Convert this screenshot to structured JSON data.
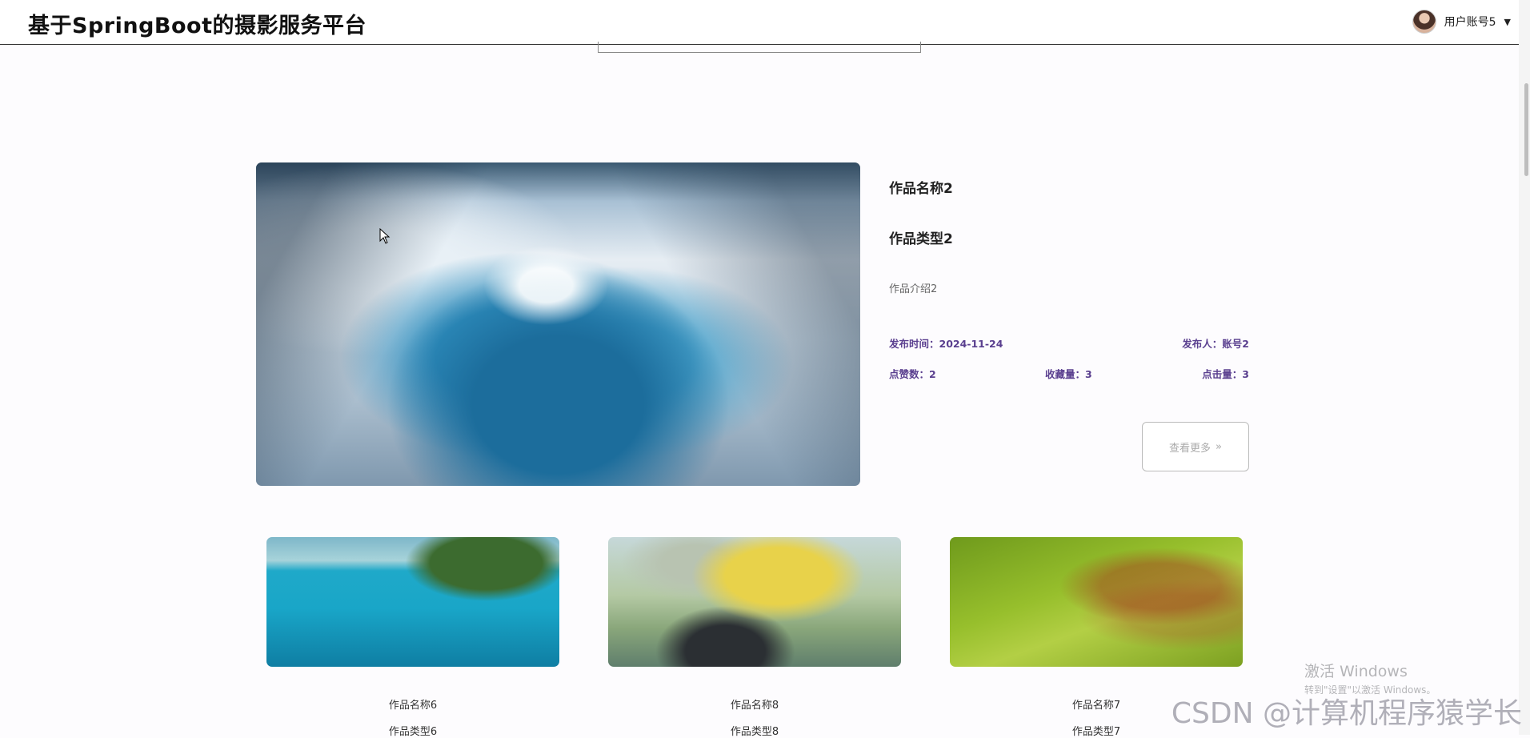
{
  "header": {
    "title": "基于SpringBoot的摄影服务平台",
    "user": {
      "name": "用户账号5"
    }
  },
  "featured": {
    "name": "作品名称2",
    "type": "作品类型2",
    "intro": "作品介绍2",
    "publish_time": "发布时间：2024-11-24",
    "publisher": "发布人：账号2",
    "likes": "点赞数：2",
    "favorites": "收藏量：3",
    "clicks": "点击量：3",
    "more_label": "查看更多",
    "more_icon": "»"
  },
  "cards": [
    {
      "name": "作品名称6",
      "type": "作品类型6"
    },
    {
      "name": "作品名称8",
      "type": "作品类型8"
    },
    {
      "name": "作品名称7",
      "type": "作品类型7"
    }
  ],
  "overlay": {
    "activation_title": "激活 Windows",
    "activation_sub": "转到\"设置\"以激活 Windows。",
    "watermark": "CSDN @计算机程序猿学长"
  }
}
